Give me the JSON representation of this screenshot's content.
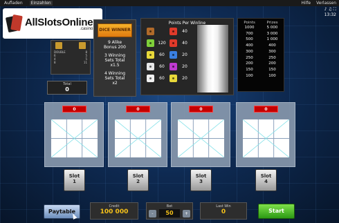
{
  "topbar": {
    "tab_load": "Aufladen",
    "tab_pay": "Einzahlen",
    "help": "Hilfe",
    "leave": "Verlassen",
    "time": "13:32"
  },
  "logo": {
    "main": "AllSlotsOnline",
    "sub": ".casino"
  },
  "mini_panel": {
    "rows": [
      [
        "DOUBLE",
        "8"
      ],
      [
        "6",
        "5"
      ],
      [
        "4",
        "5"
      ],
      [
        "8",
        "11"
      ]
    ]
  },
  "total": {
    "label": "Total",
    "value": "0"
  },
  "dice_winner": {
    "logo": "DICE WINNER",
    "line1": "9 Alike",
    "line2": "Bonus 200",
    "line3": "3 Winning",
    "line4": "Sets Total",
    "line5": "x1.5",
    "line6": "4 Winning",
    "line7": "Sets Total",
    "line8": "x2"
  },
  "points_per_winline": {
    "title": "Points Per Winline",
    "rows": [
      {
        "v1": "",
        "v2": "40",
        "c1": "#b06a2a",
        "c2": "#e03a2a",
        "c3": "#d8d8d8"
      },
      {
        "v1": "120",
        "v2": "40",
        "c1": "#7fd03a",
        "c2": "#e03a2a",
        "c3": "#c8c8c8"
      },
      {
        "v1": "60",
        "v2": "20",
        "c1": "#e8d83a",
        "c2": "#3a7fe0",
        "c3": "#c8c8c8"
      },
      {
        "v1": "60",
        "v2": "20",
        "c1": "#e8e8e8",
        "c2": "#c03ad0",
        "c3": "#c8c8c8"
      },
      {
        "v1": "60",
        "v2": "20",
        "c1": "#f0f0f0",
        "c2": "#e8d83a",
        "c3": "#c8c8c8"
      }
    ]
  },
  "points_table": {
    "head_points": "Points",
    "head_prizes": "Prizes",
    "rows": [
      [
        "1000",
        "5 000"
      ],
      [
        "700",
        "3 000"
      ],
      [
        "500",
        "1 000"
      ],
      [
        "400",
        "400"
      ],
      [
        "300",
        "300"
      ],
      [
        "250",
        "250"
      ],
      [
        "200",
        "200"
      ],
      [
        "150",
        "150"
      ],
      [
        "100",
        "100"
      ]
    ]
  },
  "slots": [
    {
      "score": "0",
      "button_label": "Slot",
      "button_num": "1"
    },
    {
      "score": "0",
      "button_label": "Slot",
      "button_num": "2"
    },
    {
      "score": "0",
      "button_label": "Slot",
      "button_num": "3"
    },
    {
      "score": "0",
      "button_label": "Slot",
      "button_num": "4"
    }
  ],
  "controls": {
    "paytable": "Paytable",
    "credit_label": "Credit",
    "credit_value": "100 000",
    "bet_label": "Bet",
    "bet_value": "50",
    "bet_minus": "-",
    "bet_plus": "+",
    "lastwin_label": "Last Win",
    "lastwin_value": "0",
    "start": "Start"
  }
}
